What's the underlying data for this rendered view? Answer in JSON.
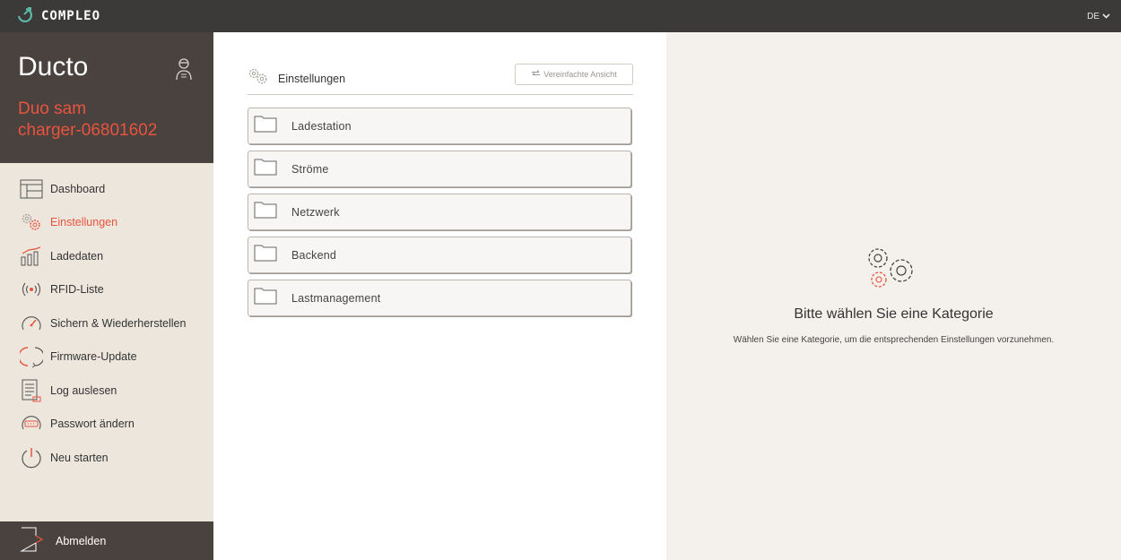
{
  "topbar": {
    "brand": "COMPLEO",
    "language": "DE"
  },
  "device": {
    "name": "Ducto",
    "subtitle_line1": "Duo sam",
    "subtitle_line2": "charger-06801602"
  },
  "sidebar": {
    "items": [
      {
        "label": "Dashboard",
        "icon": "dashboard-icon"
      },
      {
        "label": "Einstellungen",
        "icon": "settings-icon",
        "active": true
      },
      {
        "label": "Ladedaten",
        "icon": "chart-icon"
      },
      {
        "label": "RFID-Liste",
        "icon": "rfid-icon"
      },
      {
        "label": "Sichern & Wiederherstellen",
        "icon": "gauge-icon"
      },
      {
        "label": "Firmware-Update",
        "icon": "refresh-icon"
      },
      {
        "label": "Log auslesen",
        "icon": "log-icon"
      },
      {
        "label": "Passwort ändern",
        "icon": "password-icon"
      },
      {
        "label": "Neu starten",
        "icon": "power-icon"
      }
    ],
    "logout_label": "Abmelden"
  },
  "settings": {
    "title": "Einstellungen",
    "simple_view_label": "Vereinfachte Ansicht",
    "categories": [
      {
        "label": "Ladestation"
      },
      {
        "label": "Ströme"
      },
      {
        "label": "Netzwerk"
      },
      {
        "label": "Backend"
      },
      {
        "label": "Lastmanagement"
      }
    ]
  },
  "detail": {
    "title": "Bitte wählen Sie eine Kategorie",
    "subtitle": "Wählen Sie eine Kategorie, um die entsprechenden Einstellungen vorzunehmen."
  },
  "colors": {
    "accent": "#e8543f",
    "topbar": "#3b3a39",
    "sidebar_dark": "#4a423f",
    "sidebar_light": "#ece6dd",
    "panel": "#f4f1ed"
  }
}
